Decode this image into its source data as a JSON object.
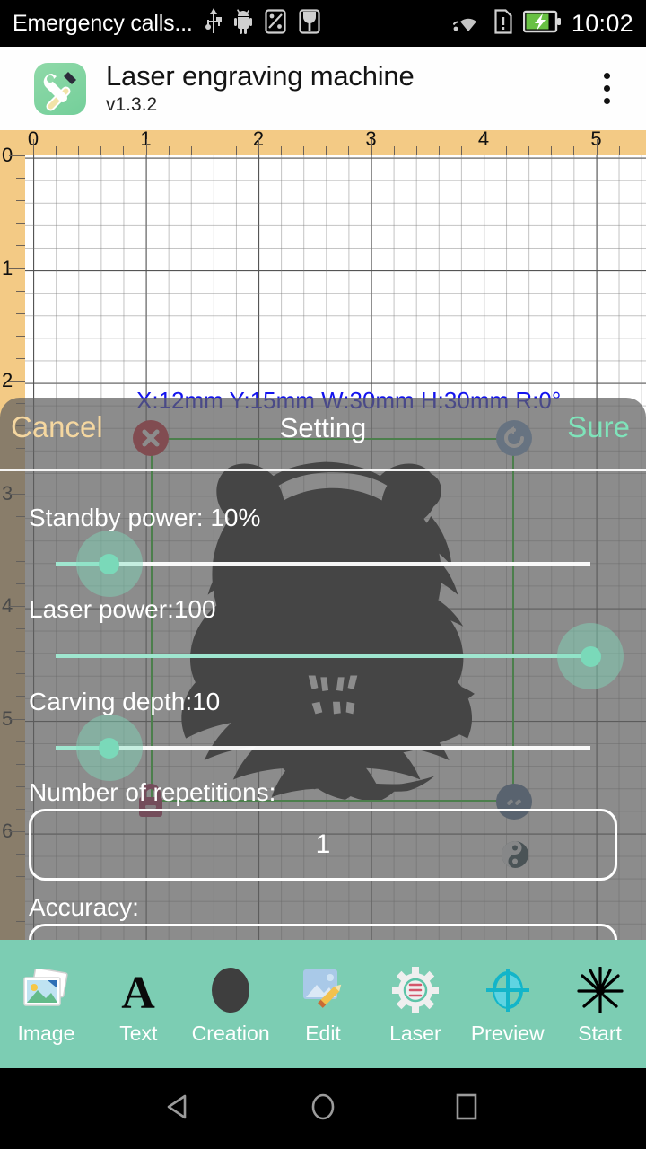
{
  "statusbar": {
    "carrier": "Emergency calls...",
    "clock": "10:02",
    "icons_left": [
      "usb-icon",
      "android-debug-icon",
      "screenshot-icon",
      "sim-tray-icon"
    ],
    "icons_right": [
      "wifi-icon",
      "sim-card-icon",
      "battery-charging-icon"
    ]
  },
  "appbar": {
    "icon": "tools-app-icon",
    "title": "Laser engraving machine",
    "version": "v1.3.2",
    "overflow": "more-options-icon"
  },
  "canvas": {
    "dimension_text": "X:12mm  Y:15mm  W:30mm  H:30mm  R:0°",
    "h_ruler_labels": [
      "0",
      "1",
      "2",
      "3",
      "4",
      "5"
    ],
    "v_ruler_labels": [
      "0",
      "1",
      "2",
      "3",
      "4",
      "5",
      "6"
    ],
    "handles": {
      "delete": "close-icon",
      "rotate": "rotate-icon",
      "resize": "resize-icon",
      "lock": "lock-icon",
      "mirror": "yin-yang-icon"
    },
    "artwork": "tiger-head-lineart",
    "selection_color": "#19d119",
    "dimension_color": "#1414ee"
  },
  "dialog": {
    "cancel_label": "Cancel",
    "title": "Setting",
    "sure_label": "Sure",
    "cancel_color": "#f5d7a0",
    "sure_color": "#7fe3ba",
    "fields": [
      {
        "label": "Standby power:  10%",
        "type": "slider",
        "value": 10,
        "min": 0,
        "max": 100
      },
      {
        "label": "Laser power:100",
        "type": "slider",
        "value": 100,
        "min": 0,
        "max": 100
      },
      {
        "label": "Carving depth:10",
        "type": "slider",
        "value": 10,
        "min": 0,
        "max": 100
      },
      {
        "label": "Number of repetitions:",
        "type": "textbox",
        "value": "1"
      },
      {
        "label": "Accuracy:",
        "type": "textbox",
        "value": ""
      }
    ]
  },
  "toolbar": {
    "items": [
      {
        "label": "Image",
        "icon": "photos-icon"
      },
      {
        "label": "Text",
        "icon": "letter-a-icon"
      },
      {
        "label": "Creation",
        "icon": "ellipse-icon"
      },
      {
        "label": "Edit",
        "icon": "image-pencil-icon"
      },
      {
        "label": "Laser",
        "icon": "gear-icon"
      },
      {
        "label": "Preview",
        "icon": "crosshair-icon"
      },
      {
        "label": "Start",
        "icon": "laser-burst-icon"
      }
    ],
    "background_color": "#7ccdb3"
  },
  "navbar": {
    "back": "back-triangle-icon",
    "home": "home-circle-icon",
    "recents": "recents-square-icon"
  }
}
